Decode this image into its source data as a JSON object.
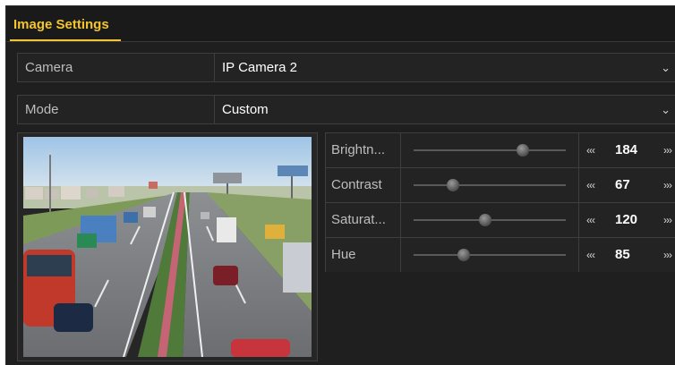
{
  "tab": {
    "label": "Image Settings"
  },
  "camera": {
    "label": "Camera",
    "value": "IP Camera 2"
  },
  "mode": {
    "label": "Mode",
    "value": "Custom"
  },
  "preview": {
    "icon": "camera-preview"
  },
  "adjustments": [
    {
      "label": "Brightn...",
      "value": "184",
      "level": 0.72
    },
    {
      "label": "Contrast",
      "value": "67",
      "level": 0.26
    },
    {
      "label": "Saturat...",
      "value": "120",
      "level": 0.47
    },
    {
      "label": "Hue",
      "value": "85",
      "level": 0.33
    }
  ],
  "colors": {
    "accent": "#f2c531",
    "background": "#1f1f1f",
    "border": "#3e3e3e"
  }
}
